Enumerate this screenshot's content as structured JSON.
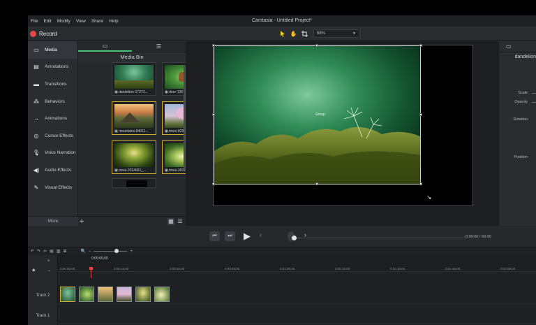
{
  "menubar": {
    "items": [
      "File",
      "Edit",
      "Modify",
      "View",
      "Share",
      "Help"
    ]
  },
  "app_title": "Camtasia - Untitled Project*",
  "toolbar": {
    "record_label": "Record",
    "zoom_value": "68%"
  },
  "leftnav": {
    "items": [
      {
        "label": "Media",
        "icon": "media-icon"
      },
      {
        "label": "Annotations",
        "icon": "annotations-icon"
      },
      {
        "label": "Transitions",
        "icon": "transitions-icon"
      },
      {
        "label": "Behaviors",
        "icon": "behaviors-icon"
      },
      {
        "label": "Animations",
        "icon": "animations-icon"
      },
      {
        "label": "Cursor Effects",
        "icon": "cursor-effects-icon"
      },
      {
        "label": "Voice Narration",
        "icon": "voice-narration-icon"
      },
      {
        "label": "Audio Effects",
        "icon": "audio-effects-icon"
      },
      {
        "label": "Visual Effects",
        "icon": "visual-effects-icon"
      }
    ],
    "more_label": "More"
  },
  "mediabin": {
    "title": "Media Bin",
    "items": [
      {
        "caption": "dandelion-17373...",
        "selected": false
      },
      {
        "caption": "deer-1367217_...3...",
        "selected": false
      },
      {
        "caption": "mountains-84011...",
        "selected": true
      },
      {
        "caption": "trees-8285288_...",
        "selected": true
      },
      {
        "caption": "trees-3294681_...",
        "selected": true
      },
      {
        "caption": "trees-3822919_9...",
        "selected": true
      }
    ]
  },
  "canvas": {
    "selection_label": "Group"
  },
  "playback": {
    "time_current": "0:00:00",
    "time_separator": "/",
    "time_total": "00:30"
  },
  "properties": {
    "name": "dandelion",
    "labels": {
      "scale": "Scale",
      "opacity": "Opacity",
      "rotation": "Rotation",
      "position": "Position"
    }
  },
  "timeline": {
    "playhead_time": "0:00:00;00",
    "ruler_ticks": [
      "0:00:00;00",
      "0:00:15;00",
      "0:00:30;00",
      "0:00:45;00",
      "0:01:00;00",
      "0:01:15;00",
      "0:01:30;00",
      "0:01:45;00",
      "0:02:00;00"
    ],
    "tracks": [
      {
        "label": "Track 2"
      },
      {
        "label": "Track 1"
      }
    ]
  },
  "colors": {
    "accent_green": "#4cc37a",
    "record_red": "#e54747",
    "selection_gold": "#d4ae33"
  }
}
